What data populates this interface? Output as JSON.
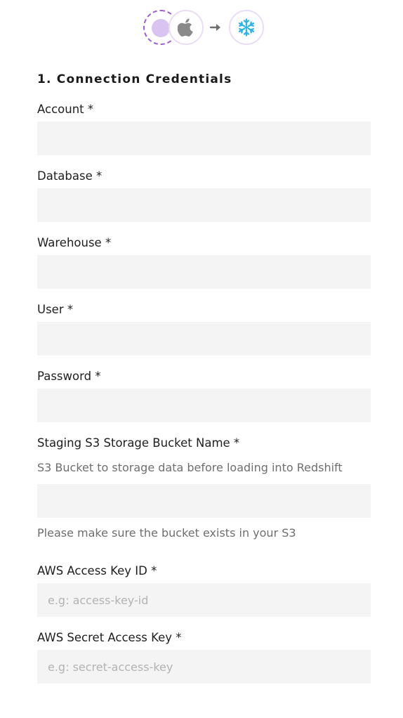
{
  "header": {
    "source_icon": "custom-source-icon",
    "app_icon": "apple-icon",
    "arrow_icon": "arrow-right-icon",
    "destination_icon": "snowflake-icon",
    "accent_color": "#9b5fd4",
    "snowflake_color": "#29b5e8"
  },
  "section": {
    "title": "1. Connection Credentials"
  },
  "fields": {
    "account": {
      "label": "Account *",
      "value": "",
      "placeholder": ""
    },
    "database": {
      "label": "Database *",
      "value": "",
      "placeholder": ""
    },
    "warehouse": {
      "label": "Warehouse *",
      "value": "",
      "placeholder": ""
    },
    "user": {
      "label": "User *",
      "value": "",
      "placeholder": ""
    },
    "password": {
      "label": "Password *",
      "value": "",
      "placeholder": ""
    },
    "bucket": {
      "label": "Staging S3 Storage Bucket Name *",
      "description": "S3 Bucket to storage data before loading into Redshift",
      "value": "",
      "placeholder": "",
      "hint": "Please make sure the bucket exists in your S3"
    },
    "access_key": {
      "label": "AWS Access Key ID *",
      "value": "",
      "placeholder": "e.g: access-key-id"
    },
    "secret_key": {
      "label": "AWS Secret Access Key *",
      "value": "",
      "placeholder": "e.g: secret-access-key"
    }
  }
}
